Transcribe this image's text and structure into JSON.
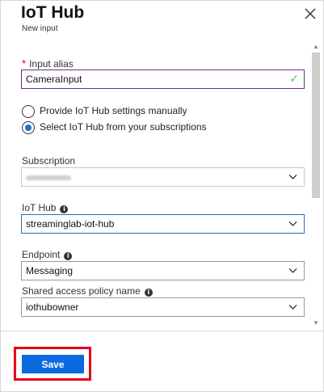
{
  "header": {
    "title": "IoT Hub",
    "subtitle": "New input",
    "close_icon": "close-icon"
  },
  "form": {
    "input_alias": {
      "required_mark": "*",
      "label": "Input alias",
      "value": "CameraInput",
      "valid_icon": "checkmark-icon",
      "valid_color": "#5cb85c"
    },
    "source_options": [
      {
        "label": "Provide IoT Hub settings manually",
        "selected": false
      },
      {
        "label": "Select IoT Hub from your subscriptions",
        "selected": true
      }
    ],
    "subscription": {
      "label": "Subscription",
      "value_obscured": true
    },
    "iot_hub": {
      "label": "IoT Hub",
      "value": "streaminglab-iot-hub"
    },
    "endpoint": {
      "label": "Endpoint",
      "value": "Messaging"
    },
    "shared_access_policy": {
      "label": "Shared access policy name",
      "value": "iothubowner"
    }
  },
  "footer": {
    "save_label": "Save",
    "save_color": "#0b6ae0",
    "highlight_color": "#e3001b"
  }
}
